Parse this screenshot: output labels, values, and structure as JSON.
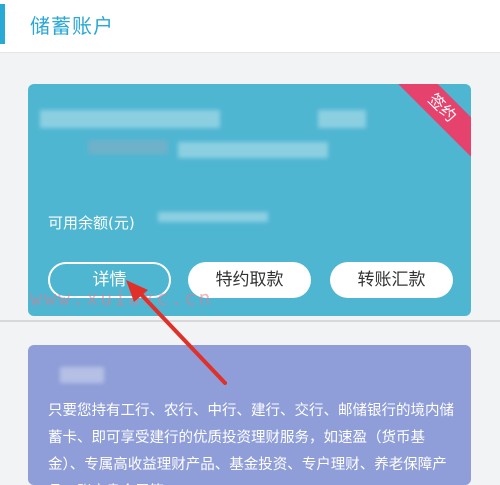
{
  "header": {
    "title": "储蓄账户"
  },
  "account": {
    "badge": "签约",
    "balance_label": "可用余额(元)",
    "buttons": {
      "details": "详情",
      "withdraw": "特约取款",
      "transfer": "转账汇款"
    }
  },
  "promo": {
    "text": "只要您持有工行、农行、中行、建行、交行、邮储银行的境内储蓄卡、即可享受建行的优质投资理财服务，如速盈（货币基金）、专属高收益理财产品、基金投资、专户理财、养老保障产品、账户贵金属等"
  },
  "watermark": "www.xuiaxc.cn",
  "colors": {
    "accent": "#29a9d6",
    "account_card": "#4fb6d2",
    "badge": "#e5436d",
    "promo_card": "#8f9ed8",
    "arrow": "#e0302a"
  }
}
